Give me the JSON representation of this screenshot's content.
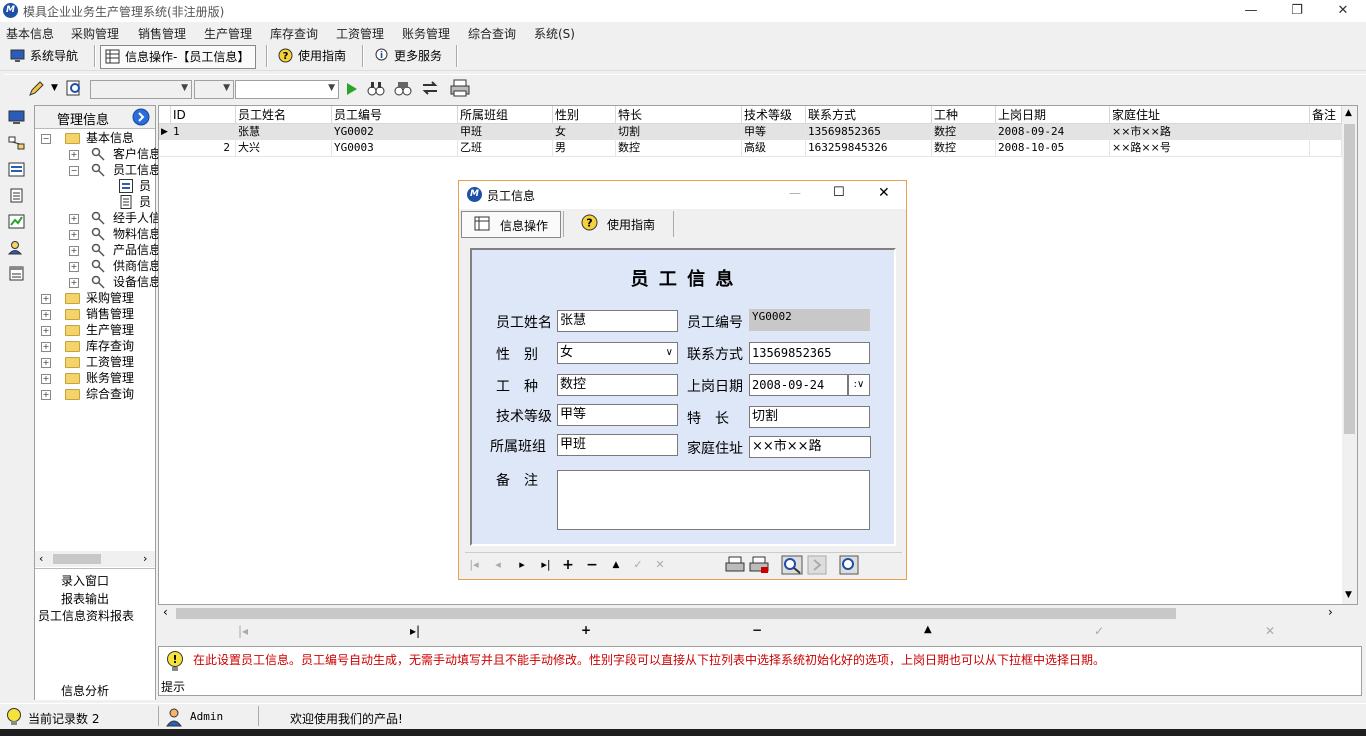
{
  "window": {
    "title": "模具企业业务生产管理系统(非注册版)",
    "logo_text": "M"
  },
  "menu": [
    "基本信息",
    "采购管理",
    "销售管理",
    "生产管理",
    "库存查询",
    "工资管理",
    "账务管理",
    "综合查询",
    "系统(S)"
  ],
  "navbar": {
    "system_nav": "系统导航",
    "info_op": "信息操作-【员工信息】",
    "guide": "使用指南",
    "more": "更多服务"
  },
  "tree": {
    "header": "管理信息",
    "items": [
      {
        "label": "基本信息"
      },
      {
        "label": "客户信息"
      },
      {
        "label": "员工信息"
      },
      {
        "label": "员"
      },
      {
        "label": "员"
      },
      {
        "label": "经手人信"
      },
      {
        "label": "物料信息"
      },
      {
        "label": "产品信息"
      },
      {
        "label": "供商信息"
      },
      {
        "label": "设备信息"
      },
      {
        "label": "采购管理"
      },
      {
        "label": "销售管理"
      },
      {
        "label": "生产管理"
      },
      {
        "label": "库存查询"
      },
      {
        "label": "工资管理"
      },
      {
        "label": "账务管理"
      },
      {
        "label": "综合查询"
      }
    ],
    "bottom": {
      "entry": "录入窗口",
      "report": "报表输出",
      "report_item": "员工信息资料报表",
      "analysis": "信息分析"
    }
  },
  "grid": {
    "columns": [
      "ID",
      "员工姓名",
      "员工编号",
      "所属班组",
      "性别",
      "特长",
      "技术等级",
      "联系方式",
      "工种",
      "上岗日期",
      "家庭住址",
      "备注"
    ],
    "rows": [
      {
        "id": "1",
        "name": "张慧",
        "code": "YG0002",
        "team": "甲班",
        "gender": "女",
        "skill": "切割",
        "level": "甲等",
        "phone": "13569852365",
        "job": "数控",
        "date": "2008-09-24",
        "address": "××市××路",
        "remark": ""
      },
      {
        "id": "2",
        "name": "大兴",
        "code": "YG0003",
        "team": "乙班",
        "gender": "男",
        "skill": "数控",
        "level": "高级",
        "phone": "163259845326",
        "job": "数控",
        "date": "2008-10-05",
        "address": "××路××号",
        "remark": ""
      }
    ]
  },
  "dialog": {
    "title": "员工信息",
    "tabs": {
      "info_op": "信息操作",
      "guide": "使用指南"
    },
    "form_title": "员 工 信 息",
    "labels": {
      "name": "员工姓名",
      "code": "员工编号",
      "gender": "性　别",
      "phone": "联系方式",
      "job": "工　种",
      "date": "上岗日期",
      "level": "技术等级",
      "skill": "特　长",
      "team": "所属班组",
      "address": "家庭住址",
      "remark": "备　注"
    },
    "values": {
      "name": "张慧",
      "code": "YG0002",
      "gender": "女",
      "phone": "13569852365",
      "job": "数控",
      "date": "2008-09-24",
      "level": "甲等",
      "skill": "切割",
      "team": "甲班",
      "address": "××市××路",
      "remark": ""
    }
  },
  "hint": {
    "text": "在此设置员工信息。员工编号自动生成，无需手动填写并且不能手动修改。性别字段可以直接从下拉列表中选择系统初始化好的选项，上岗日期也可以从下拉框中选择日期。",
    "label": "提示"
  },
  "status": {
    "record_count": "当前记录数 2",
    "user": "Admin",
    "welcome": "欢迎使用我们的产品!"
  },
  "colors": {
    "hint_text": "#cc0000",
    "form_bg": "#dde7f7",
    "dialog_border": "#e6a050"
  }
}
